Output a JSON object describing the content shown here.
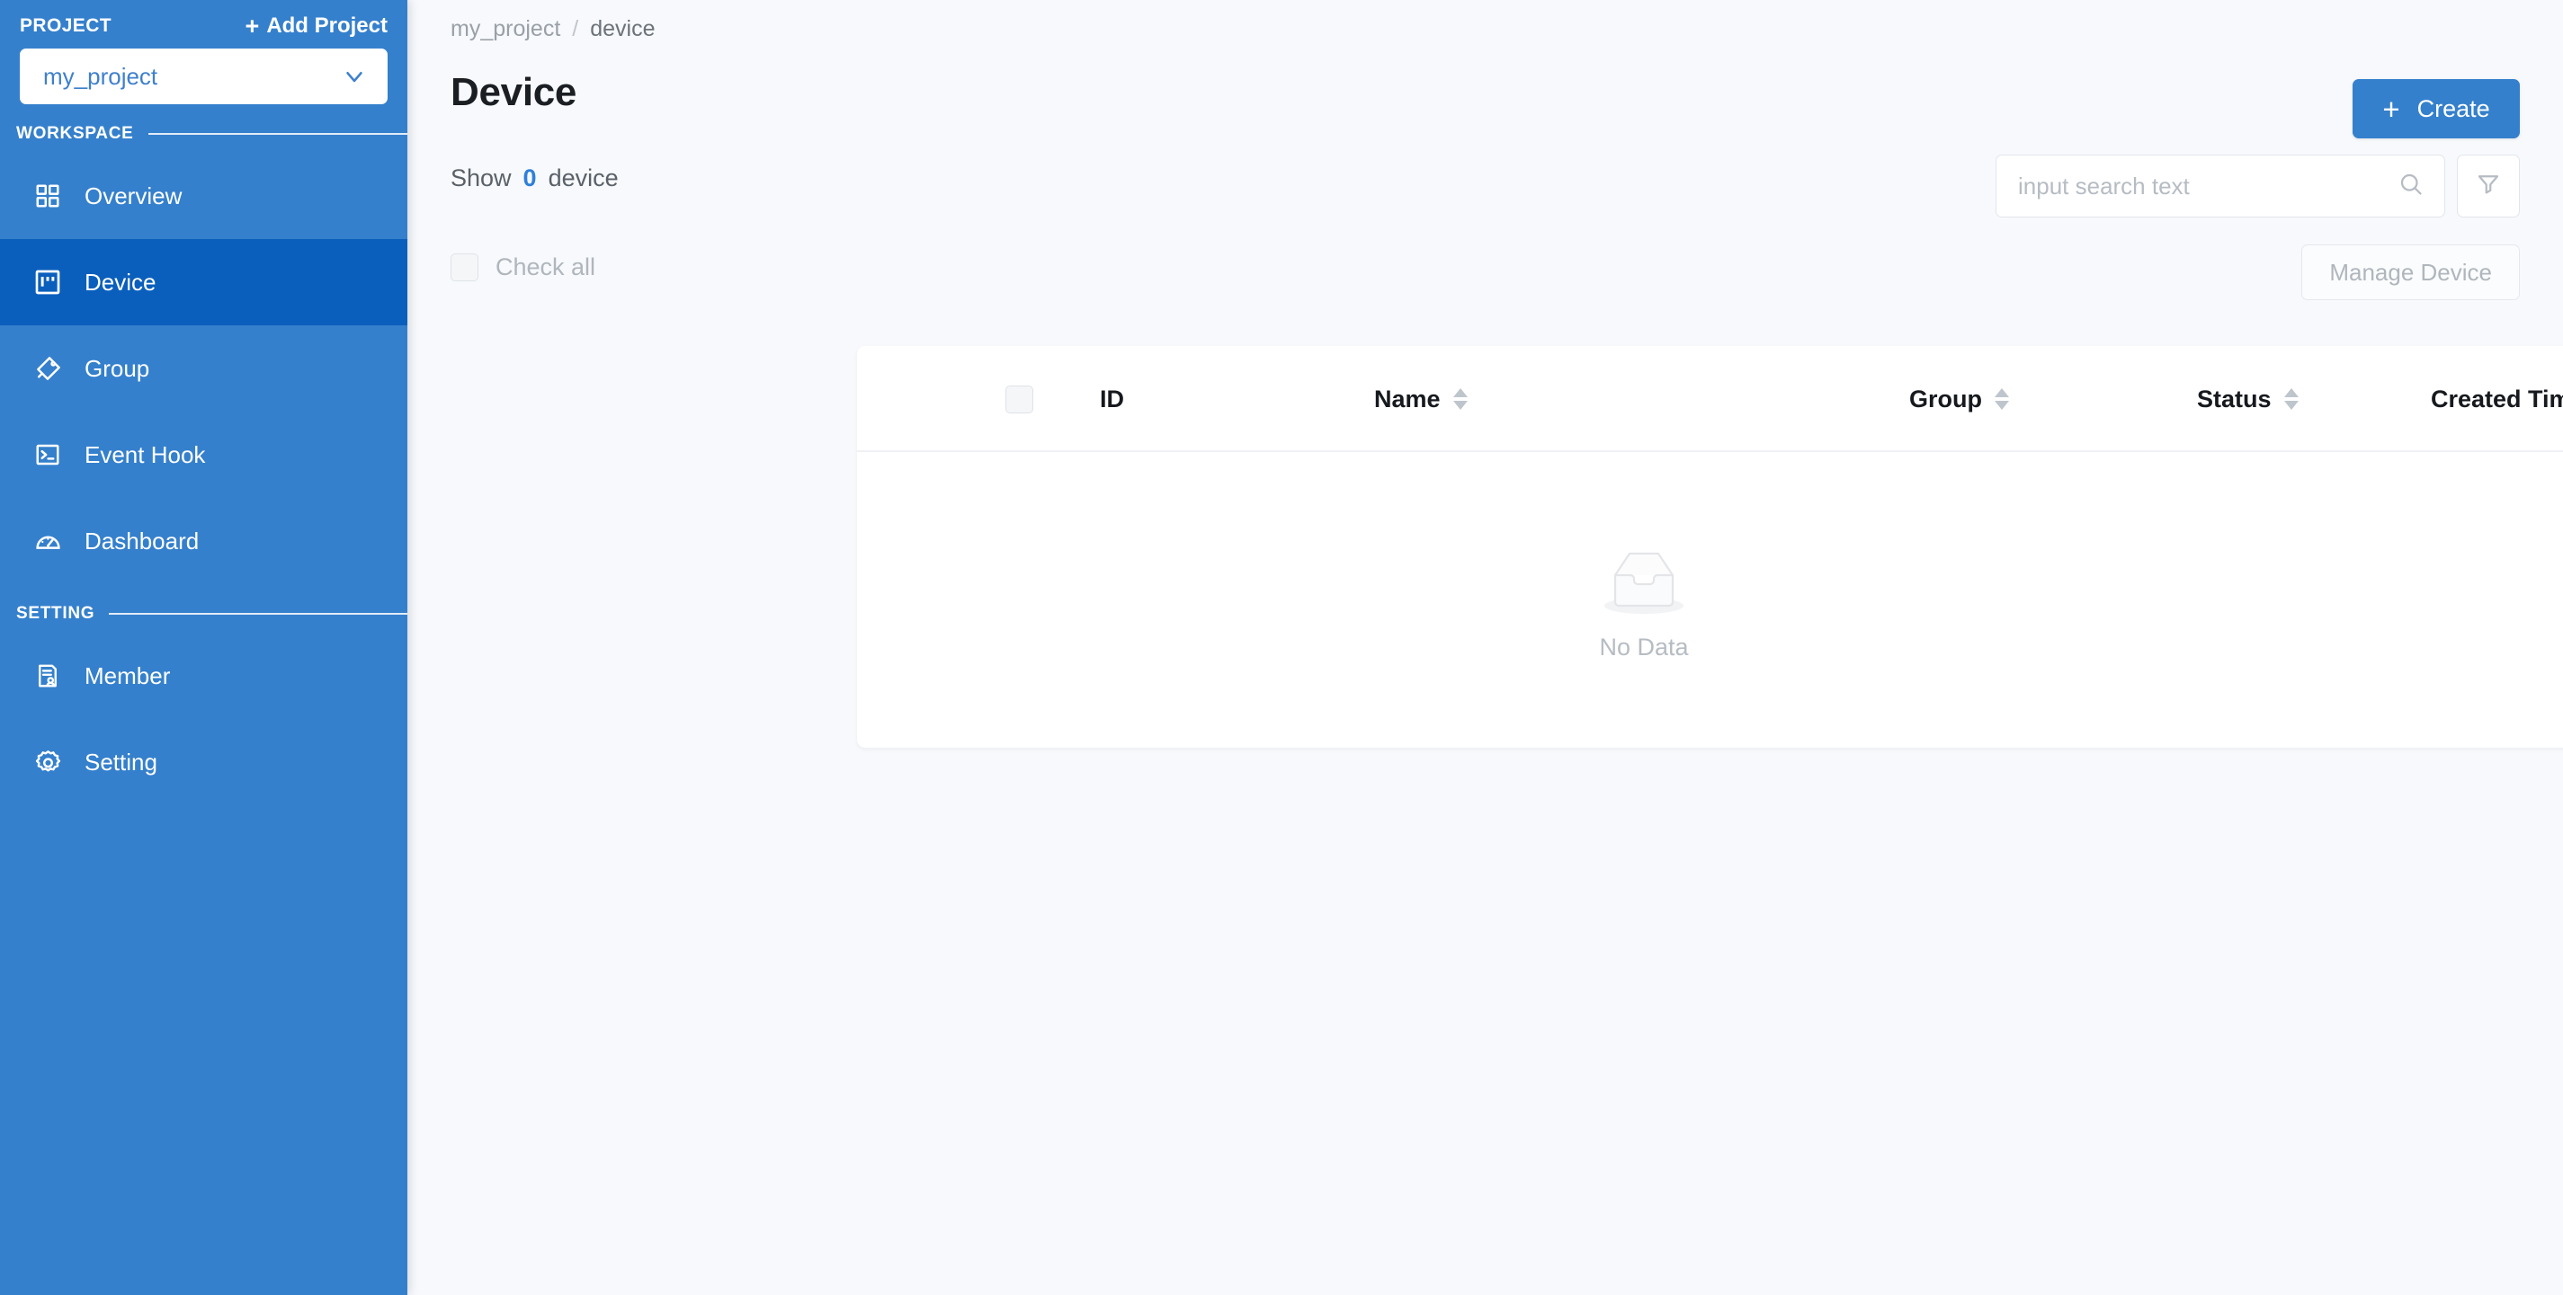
{
  "sidebar": {
    "project_label": "PROJECT",
    "add_project_label": "Add Project",
    "add_project_plus": "+",
    "project_select": {
      "value": "my_project",
      "caret_icon": "chevron-down-icon"
    },
    "sections": [
      {
        "title": "WORKSPACE"
      },
      {
        "title": "SETTING"
      }
    ],
    "workspace_items": [
      {
        "label": "Overview",
        "icon": "grid-icon",
        "active": false
      },
      {
        "label": "Device",
        "icon": "device-icon",
        "active": true
      },
      {
        "label": "Group",
        "icon": "tag-icon",
        "active": false
      },
      {
        "label": "Event Hook",
        "icon": "terminal-icon",
        "active": false
      },
      {
        "label": "Dashboard",
        "icon": "gauge-icon",
        "active": false
      }
    ],
    "setting_items": [
      {
        "label": "Member",
        "icon": "member-icon",
        "active": false
      },
      {
        "label": "Setting",
        "icon": "gear-icon",
        "active": false
      }
    ]
  },
  "breadcrumb": {
    "root": "my_project",
    "separator": "/",
    "current": "device"
  },
  "page": {
    "title": "Device",
    "show_prefix": "Show",
    "show_count": "0",
    "show_suffix": "device"
  },
  "toolbar": {
    "create_label": "Create",
    "create_plus": "+",
    "search_placeholder": "input search text",
    "search_value": "",
    "search_icon": "search-icon",
    "filter_icon": "filter-icon",
    "check_all_label": "Check all",
    "check_all_checked": false,
    "manage_label": "Manage Device"
  },
  "table": {
    "columns": [
      {
        "label": "ID",
        "sortable": false,
        "sort": "none"
      },
      {
        "label": "Name",
        "sortable": true,
        "sort": "none"
      },
      {
        "label": "Group",
        "sortable": true,
        "sort": "none"
      },
      {
        "label": "Status",
        "sortable": true,
        "sort": "none"
      },
      {
        "label": "Created Time",
        "sortable": true,
        "sort": "desc"
      }
    ],
    "rows": [],
    "empty_label": "No Data",
    "empty_icon": "empty-inbox-icon"
  },
  "colors": {
    "sidebar_bg": "#3580cc",
    "sidebar_active": "#0b5fbc",
    "accent": "#2f80d8",
    "primary_button": "#3580cc",
    "page_bg": "#f7f9fc",
    "card_bg": "#ffffff",
    "muted_text": "#b6bcc3",
    "sort_active": "#2f80d8"
  }
}
